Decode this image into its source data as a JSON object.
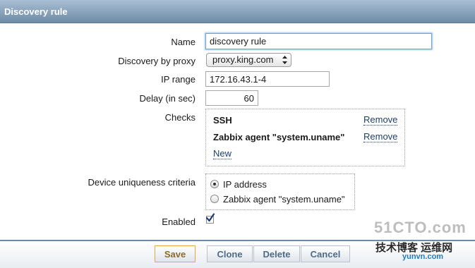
{
  "title": "Discovery rule",
  "form": {
    "name_label": "Name",
    "name_value": "discovery rule",
    "proxy_label": "Discovery by proxy",
    "proxy_value": "proxy.king.com",
    "ip_range_label": "IP range",
    "ip_range_value": "172.16.43.1-4",
    "delay_label": "Delay (in sec)",
    "delay_value": "60",
    "checks_label": "Checks",
    "checks": [
      {
        "name": "SSH",
        "remove": "Remove"
      },
      {
        "name": "Zabbix agent \"system.uname\"",
        "remove": "Remove"
      }
    ],
    "new_link": "New",
    "uniqueness_label": "Device uniqueness criteria",
    "uniqueness_options": [
      "IP address",
      "Zabbix agent \"system.uname\""
    ],
    "uniqueness_selected": "IP address",
    "enabled_label": "Enabled",
    "enabled": true
  },
  "buttons": {
    "save": "Save",
    "clone": "Clone",
    "delete": "Delete",
    "cancel": "Cancel"
  },
  "watermark": {
    "line1": "51CTO.com",
    "line2": "技术博客 运维网",
    "line3": "yunvn.com"
  },
  "colors": {
    "header": "#6e8ba6",
    "link": "#1e3f6b",
    "save_border": "#f0a640"
  },
  "icons": [
    "select-arrows-icon",
    "checkmark-icon"
  ]
}
